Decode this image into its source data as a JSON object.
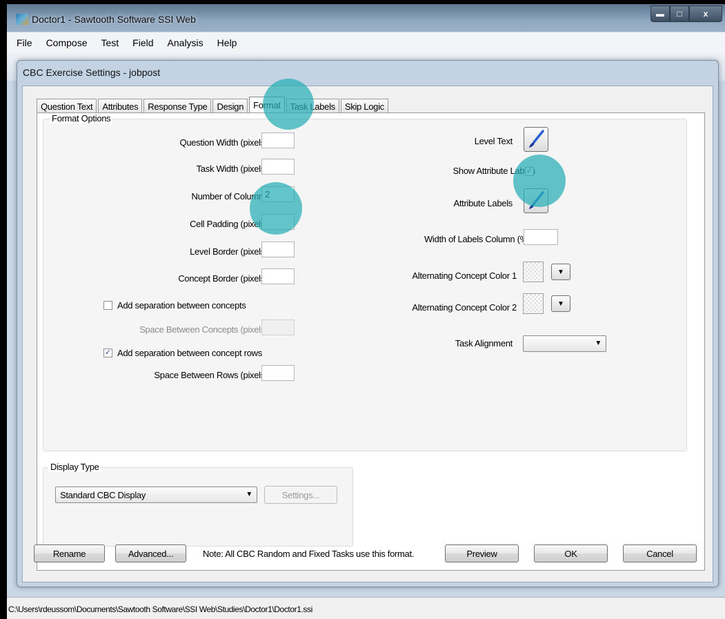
{
  "app": {
    "title": "Doctor1 - Sawtooth Software SSI Web"
  },
  "window_buttons": {
    "minimize": "▬",
    "maximize": "□",
    "close": "x"
  },
  "menu": [
    "File",
    "Compose",
    "Test",
    "Field",
    "Analysis",
    "Help"
  ],
  "dialog": {
    "title": "CBC Exercise Settings - jobpost",
    "tabs": [
      "Question Text",
      "Attributes",
      "Response Type",
      "Design",
      "Format",
      "Task Labels",
      "Skip Logic"
    ],
    "active_tab": "Format",
    "format_options": {
      "group_label": "Format Options",
      "question_width_label": "Question Width (pixels)",
      "question_width_value": "",
      "task_width_label": "Task Width (pixels)",
      "task_width_value": "",
      "num_columns_label": "Number of Columns",
      "num_columns_value": "2",
      "cell_padding_label": "Cell Padding (pixels)",
      "cell_padding_value": "",
      "level_border_label": "Level Border (pixels)",
      "level_border_value": "",
      "concept_border_label": "Concept Border (pixels)",
      "concept_border_value": "",
      "sep_concepts_label": "Add separation between concepts",
      "sep_concepts_checked": false,
      "space_concepts_label": "Space Between Concepts (pixels)",
      "space_concepts_value": "",
      "sep_rows_label": "Add separation between concept rows",
      "sep_rows_checked": true,
      "space_rows_label": "Space Between Rows (pixels)",
      "space_rows_value": "",
      "level_text_label": "Level Text",
      "show_attr_labels_label": "Show Attribute Labels",
      "show_attr_labels_checked": true,
      "attr_labels_label": "Attribute Labels",
      "width_labels_col_label": "Width of Labels Column (%)",
      "width_labels_col_value": "",
      "alt_color1_label": "Alternating Concept Color 1",
      "alt_color2_label": "Alternating Concept Color 2",
      "task_alignment_label": "Task Alignment",
      "task_alignment_value": ""
    },
    "display_type": {
      "group_label": "Display Type",
      "selected": "Standard CBC Display",
      "settings_button": "Settings..."
    },
    "footer": {
      "rename": "Rename",
      "advanced": "Advanced...",
      "note": "Note:  All CBC Random and Fixed Tasks use this format.",
      "preview": "Preview",
      "ok": "OK",
      "cancel": "Cancel"
    }
  },
  "status_bar": {
    "path": "C:\\Users\\rdeussom\\Documents\\Sawtooth Software\\SSI Web\\Studies\\Doctor1\\Doctor1.ssi"
  },
  "colors": {
    "highlight": "#27afb4",
    "brush_blue": "#2a5fd0",
    "title_bar": "#8ea6bf"
  },
  "icons": [
    "app-icon",
    "paintbrush-icon",
    "dropdown-arrow-icon",
    "checkmark-icon"
  ]
}
